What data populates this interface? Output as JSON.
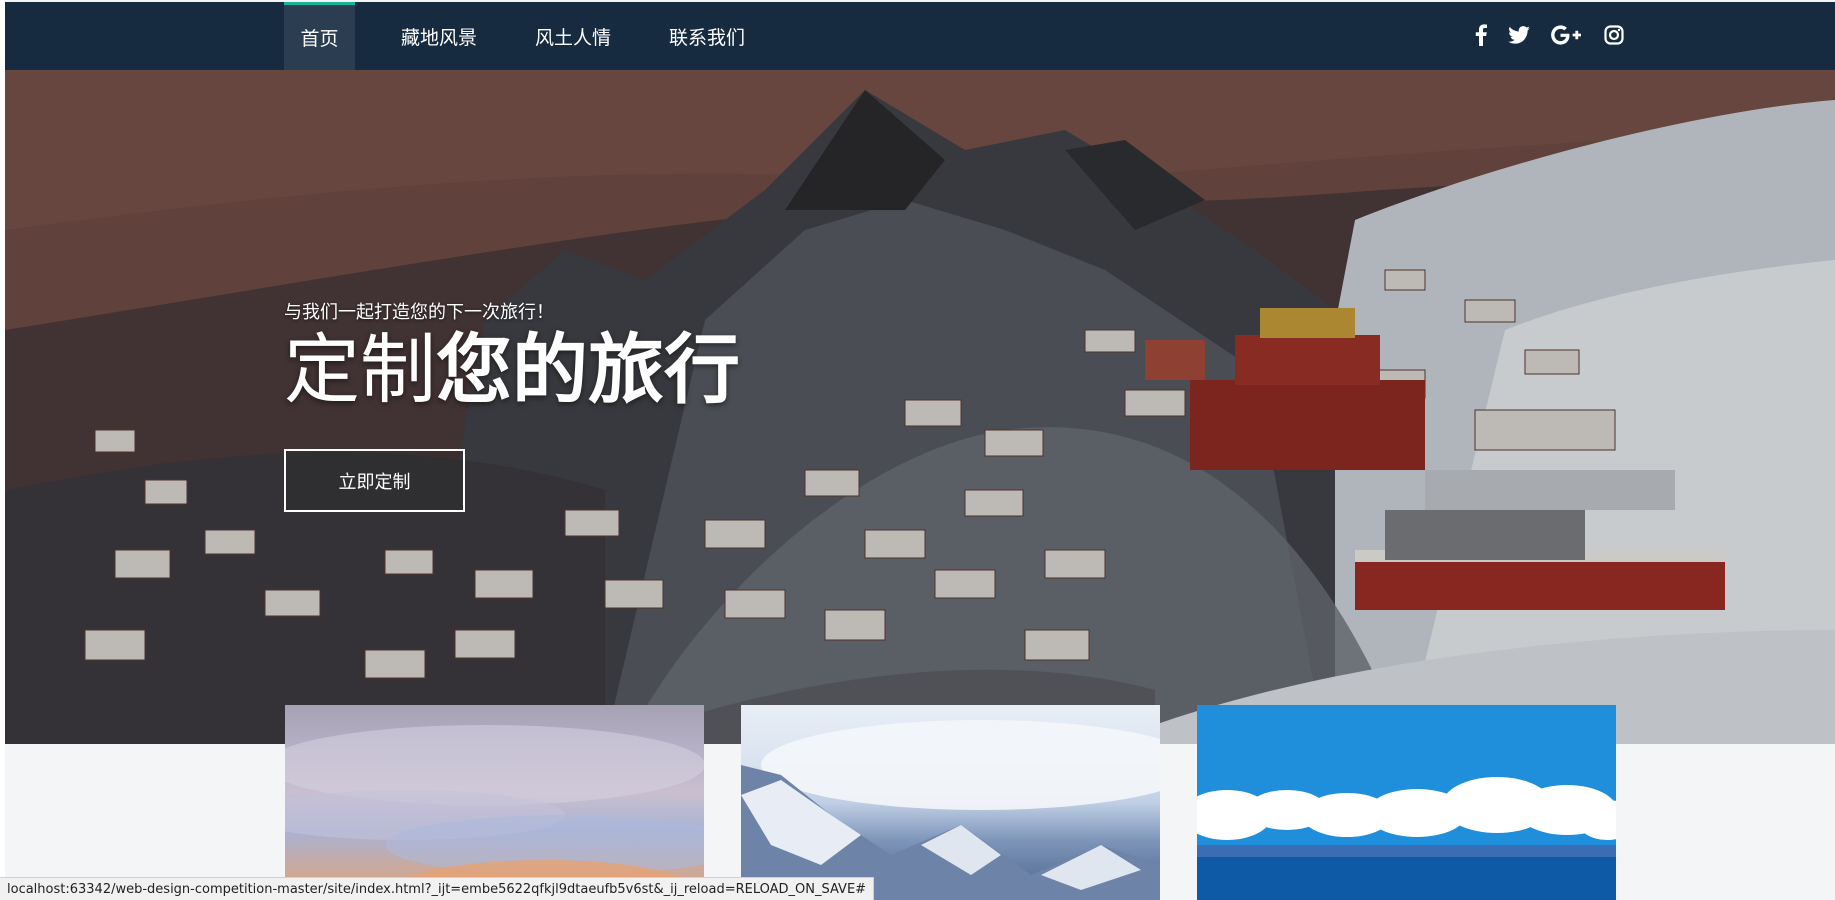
{
  "nav": {
    "items": [
      {
        "label": "首页",
        "active": true
      },
      {
        "label": "藏地风景",
        "active": false
      },
      {
        "label": "风土人情",
        "active": false
      },
      {
        "label": "联系我们",
        "active": false
      }
    ],
    "social_icons": [
      "facebook-icon",
      "twitter-icon",
      "google-plus-icon",
      "instagram-icon"
    ],
    "colors": {
      "background": "#172b40",
      "active_background": "#2b3d50",
      "accent": "#19b29a"
    }
  },
  "hero": {
    "tagline": "与我们一起打造您的下一次旅行！",
    "title_light": "定制",
    "title_bold": "您的旅行",
    "button_label": "立即定制"
  },
  "cards": [
    {
      "alt": "sky-photo"
    },
    {
      "alt": "snow-mountain-photo"
    },
    {
      "alt": "lake-photo"
    }
  ],
  "status_bar": {
    "url": "localhost:63342/web-design-competition-master/site/index.html?_ijt=embe5622qfkjl9dtaeufb5v6st&_ij_reload=RELOAD_ON_SAVE#"
  }
}
